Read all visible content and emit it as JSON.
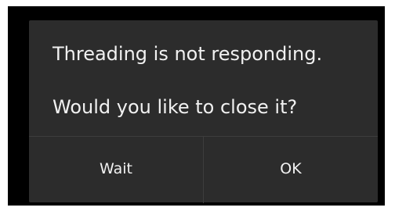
{
  "dialog": {
    "message_line1": "Threading is not responding.",
    "message_line2": "Would you like to close it?",
    "buttons": {
      "wait_label": "Wait",
      "ok_label": "OK"
    }
  }
}
